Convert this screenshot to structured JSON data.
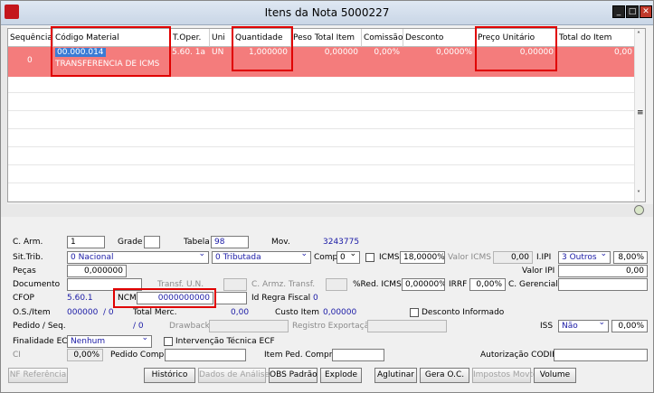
{
  "window": {
    "title": "Itens da Nota 5000227",
    "min": "_",
    "max": "□",
    "close": "✕"
  },
  "grid": {
    "headers": [
      "Sequência",
      "Código Material",
      "T.Oper.",
      "Uni",
      "Quantidade",
      "Peso Total Item",
      "Comissão",
      "Desconto",
      "Preço Unitário",
      "Total do Item"
    ],
    "row": {
      "seq": "0",
      "codigo": "00.000.014",
      "descricao": "TRANSFERENCIA DE ICMS",
      "toper": "5.60. 1a",
      "uni": "UN",
      "quantidade": "1,000000",
      "peso": "0,00000",
      "comissao": "0,00%",
      "desconto": "0,0000%",
      "preco": "0,00000",
      "total": "0,00"
    }
  },
  "form": {
    "carm_label": "C. Arm.",
    "carm": "1",
    "grade_label": "Grade",
    "grade": "",
    "tabela_label": "Tabela",
    "tabela": "98",
    "mov_label": "Mov.",
    "mov": "3243775",
    "sittrib_label": "Sit.Trib.",
    "sittrib1": "0 Nacional",
    "sittrib2": "0 Tributada",
    "compl_label": "Compl",
    "compl": "0",
    "icms_label": "ICMS",
    "icms": "18,0000%",
    "valor_icms_label": "Valor ICMS",
    "valor_icms": "0,00",
    "ipi_label": "I.IPI",
    "ipi_sel": "3 Outros",
    "ipi_pct": "8,00%",
    "pecas_label": "Peças",
    "pecas": "0,000000",
    "valor_ipi_label": "Valor IPI",
    "valor_ipi": "0,00",
    "documento_label": "Documento",
    "transf_un_label": "Transf. U.N.",
    "carmz_label": "C. Armz. Transf.",
    "red_icms_label": "%Red. ICMS",
    "red_icms": "0,00000%",
    "irrf_label": "IRRF",
    "irrf": "0,00%",
    "cgerencial_label": "C. Gerencial",
    "cfop_label": "CFOP",
    "cfop": "5.60.1",
    "ncm_label": "NCM",
    "ncm": "0000000000",
    "id_regra_label": "Id Regra Fiscal",
    "id_regra": "0",
    "os_label": "O.S./Item",
    "os": "000000",
    "os_sep": "/ 0",
    "total_merc_label": "Total Merc.",
    "total_merc": "0,00",
    "custo_label": "Custo Item",
    "custo": "0,00000",
    "desconto_inf_label": "Desconto Informado",
    "pedido_label": "Pedido / Seq.",
    "pedido_sep": "/ 0",
    "drawback_label": "Drawback",
    "registro_label": "Registro Exportação",
    "iss_label": "ISS",
    "iss_sel": "Não",
    "iss_pct": "0,00%",
    "finalidade_label": "Finalidade ECF",
    "finalidade": "Nenhum",
    "intervencao_label": "Intervenção Técnica ECF",
    "ci_label": "CI",
    "ci": "0,00%",
    "pedido_compra_label": "Pedido Compra",
    "item_ped_label": "Item Ped. Compra",
    "autorizacao_label": "Autorização CODIF"
  },
  "buttons": {
    "nf_ref": "NF Referência",
    "historico": "Histórico",
    "dados_analise": "Dados de Análise",
    "obs": "OBS Padrão",
    "explode": "Explode",
    "aglutinar": "Aglutinar",
    "gera_oc": "Gera O.C.",
    "impostos": "Impostos Movto",
    "volume": "Volume"
  }
}
